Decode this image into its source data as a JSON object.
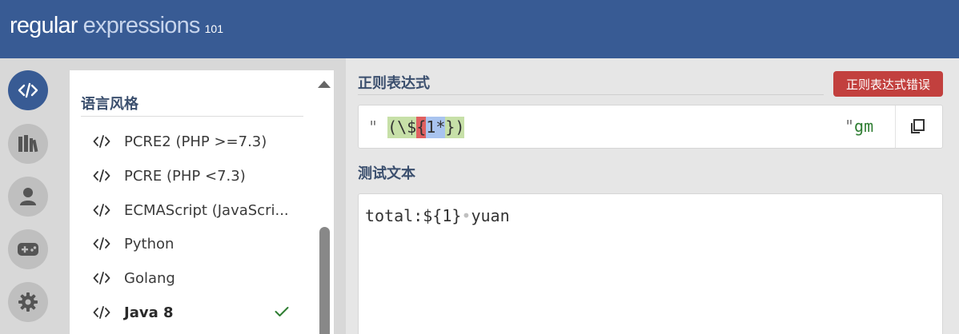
{
  "header": {
    "logo_word1": "regular",
    "logo_word2": "expressions",
    "logo_version": "101",
    "bg_color": "#385b94"
  },
  "icon_bar": [
    {
      "icon": "code-icon",
      "active": true
    },
    {
      "icon": "library-icon",
      "active": false
    },
    {
      "icon": "user-icon",
      "active": false
    },
    {
      "icon": "gamepad-icon",
      "active": false
    },
    {
      "icon": "gear-icon",
      "active": false
    }
  ],
  "flavor_panel": {
    "title": "语言风格",
    "items": [
      {
        "label": "PCRE2 (PHP >=7.3)",
        "selected": false
      },
      {
        "label": "PCRE (PHP <7.3)",
        "selected": false
      },
      {
        "label": "ECMAScript (JavaScri...",
        "selected": false
      },
      {
        "label": "Python",
        "selected": false
      },
      {
        "label": "Golang",
        "selected": false
      },
      {
        "label": "Java 8",
        "selected": true
      }
    ]
  },
  "regex_section": {
    "title": "正则表达式",
    "error_badge": "正则表达式错误",
    "delimiter_open": "\"",
    "delimiter_close": "\"",
    "flags": "gm",
    "tokens": {
      "open_paren": "(",
      "escape": "\\$",
      "brace": "{",
      "literal": "1",
      "quantifier": "*",
      "close_brace": "}",
      "close_paren": ")"
    },
    "colors": {
      "group": "#c7e0a8",
      "error": "#e06060",
      "quantifier": "#a9c4ef",
      "badge": "#c2403e"
    }
  },
  "test_section": {
    "title": "测试文本",
    "part1": "total:${1}",
    "space_marker": "•",
    "part2": "yuan"
  }
}
